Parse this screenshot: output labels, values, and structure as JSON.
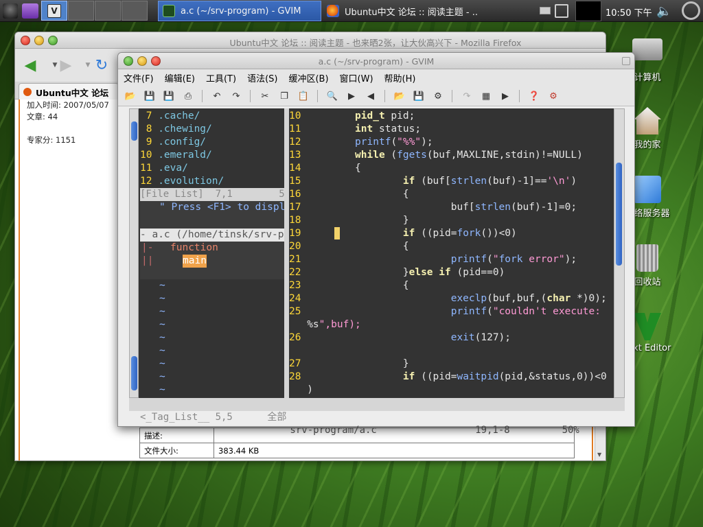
{
  "panel": {
    "tasks": [
      {
        "title": "a.c (~/srv-program) - GVIM",
        "active": true
      },
      {
        "title": "Ubuntu中文 论坛 :: 阅读主题 - ...",
        "active": false
      }
    ],
    "clock": "10:50 下午",
    "workspace_count": 4
  },
  "firefox": {
    "title": "Ubuntu中文 论坛 :: 阅读主题 - 也来晒2张，让大伙高兴下 - Mozilla Firefox",
    "tab_label": "Ubuntu中文 论坛",
    "post_info": {
      "join_time": "加入时间: 2007/05/07",
      "articles": "文章: 44",
      "expert_points": "专家分: 1151"
    },
    "attachment": [
      {
        "label": "描述:",
        "value": ""
      },
      {
        "label": "文件大小:",
        "value": "383.44 KB"
      }
    ]
  },
  "gvim": {
    "title": "a.c (~/srv-program) - GVIM",
    "menu": [
      "文件(F)",
      "编辑(E)",
      "工具(T)",
      "语法(S)",
      "缓冲区(B)",
      "窗口(W)",
      "帮助(H)"
    ],
    "file_list": [
      {
        "num": " 7",
        "name": ".cache/"
      },
      {
        "num": " 8",
        "name": ".chewing/"
      },
      {
        "num": " 9",
        "name": ".config/"
      },
      {
        "num": "10",
        "name": ".emerald/"
      },
      {
        "num": "11",
        "name": ".eva/"
      },
      {
        "num": "12",
        "name": ".evolution/"
      }
    ],
    "file_list_status": "[File List]  7,1        5%",
    "taglist": {
      "help_line": "\" Press <F1> to displa",
      "file_entry": "- a.c (/home/tinsk/srv-p",
      "fold1": "|-",
      "fold2": "||",
      "function_label": "function",
      "main_label": "main",
      "status": "<_Tag_List__ 5,5      全部"
    },
    "code_lines": [
      {
        "num": "10",
        "code": "        pid_t pid;"
      },
      {
        "num": "11",
        "code": "        int status;"
      },
      {
        "num": "12",
        "code": "        printf(\"%%\");"
      },
      {
        "num": "13",
        "code": "        while (fgets(buf,MAXLINE,stdin)!=NULL)"
      },
      {
        "num": "14",
        "code": "        {"
      },
      {
        "num": "15",
        "code": "                if (buf[strlen(buf)-1]=='\\n')"
      },
      {
        "num": "16",
        "code": "                {"
      },
      {
        "num": "17",
        "code": "                        buf[strlen(buf)-1]=0;"
      },
      {
        "num": "18",
        "code": "                }"
      },
      {
        "num": "19",
        "code": "                if ((pid=fork())<0)"
      },
      {
        "num": "20",
        "code": "                {"
      },
      {
        "num": "21",
        "code": "                        printf(\"fork error\");"
      },
      {
        "num": "22",
        "code": "                }else if (pid==0)"
      },
      {
        "num": "23",
        "code": "                {"
      },
      {
        "num": "24",
        "code": "                        execlp(buf,buf,(char *)0);"
      },
      {
        "num": "25",
        "code": "                        printf(\"couldn't execute:"
      },
      {
        "num": "",
        "code": "%s\",buf);"
      },
      {
        "num": "26",
        "code": "                        exit(127);"
      },
      {
        "num": "",
        "code": ""
      },
      {
        "num": "27",
        "code": "                }"
      },
      {
        "num": "28",
        "code": "                if ((pid=waitpid(pid,&status,0))<0"
      },
      {
        "num": "",
        "code": ")"
      }
    ],
    "status_right": " srv-program/a.c                 19,1-8         50%"
  },
  "desktop_icons": [
    {
      "label": "计算机"
    },
    {
      "label": "我的家"
    },
    {
      "label": "网络服务器"
    },
    {
      "label": "回收站"
    },
    {
      "label": "Text Editor"
    }
  ]
}
